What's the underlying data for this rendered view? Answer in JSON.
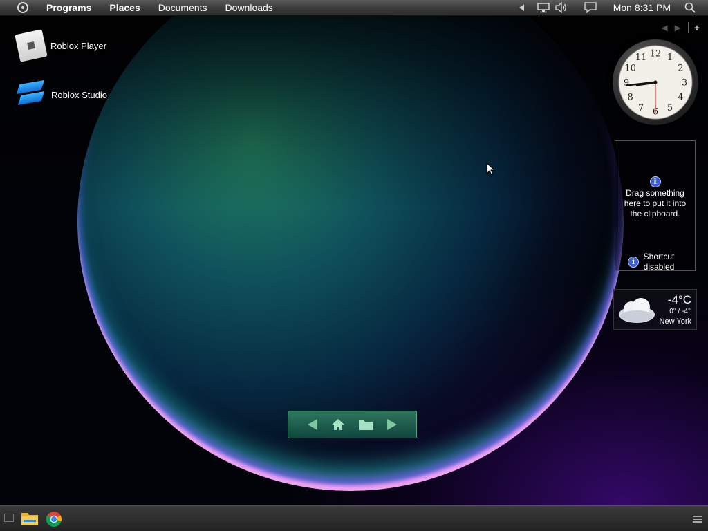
{
  "menubar": {
    "items": [
      "Programs",
      "Places",
      "Documents",
      "Downloads"
    ],
    "clock": "Mon 8:31 PM",
    "icons": [
      "start-orb-icon",
      "tray-expand-icon",
      "network-icon",
      "volume-icon",
      "action-center-icon",
      "search-icon"
    ]
  },
  "desktop": {
    "icons": [
      {
        "label": "Roblox Player",
        "icon": "roblox-player-icon"
      },
      {
        "label": "Roblox Studio",
        "icon": "roblox-studio-icon"
      }
    ]
  },
  "widgets": {
    "clock": {
      "hour": 8,
      "minute": 44,
      "second": 30
    },
    "clipboard": {
      "message": "Drag something here to put it into the clipboard.",
      "shortcut": "Shortcut disabled"
    },
    "weather": {
      "temperature": "-4°C",
      "range": "0° / -4°",
      "city": "New York",
      "icon": "cloudy-icon"
    }
  },
  "dock": {
    "items": [
      "back-icon",
      "home-icon",
      "folder-icon",
      "forward-icon"
    ]
  },
  "taskbar": {
    "items": [
      "show-desktop-icon",
      "file-explorer-icon",
      "chrome-icon",
      "menu-icon"
    ]
  },
  "colors": {
    "accent": "#3fb4ff",
    "dock": "#2f7d63"
  }
}
